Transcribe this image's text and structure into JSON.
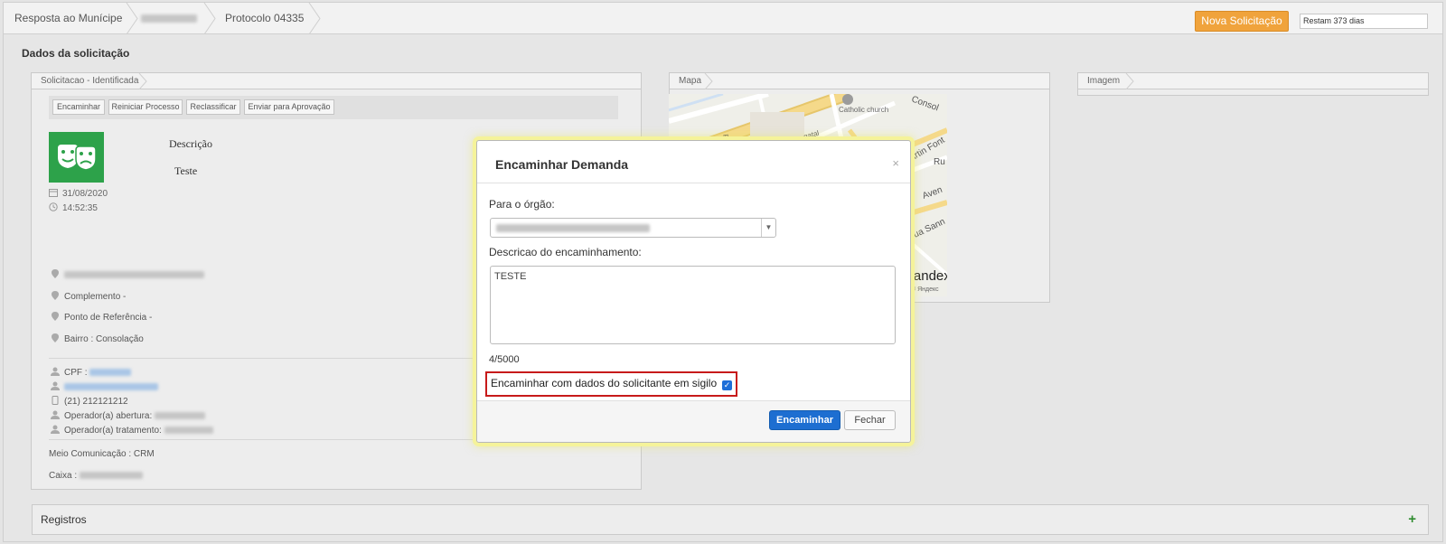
{
  "breadcrumb": {
    "item1": "Resposta ao Munícipe",
    "item3": "Protocolo 04335"
  },
  "header": {
    "new_request_label": "Nova Solicitação",
    "days_remaining": "Restam 373 dias"
  },
  "section_title": "Dados da solicitação",
  "request_panel": {
    "tab_label": "Solicitacao - Identificada",
    "actions": [
      "Encaminhar",
      "Reiniciar Processo",
      "Reclassificar",
      "Enviar para Aprovação"
    ],
    "description_title": "Descrição",
    "description_text": "Teste",
    "date": "31/08/2020",
    "time": "14:52:35",
    "complement": "Complemento -",
    "reference": "Ponto de Referência -",
    "district": "Bairro : Consolação",
    "cpf_label": "CPF :",
    "phone": "(21) 212121212",
    "operator_open_label": "Operador(a) abertura:",
    "operator_treat_label": "Operador(a) tratamento:",
    "channel": "Meio Comunicação : CRM",
    "box_label": "Caixa :"
  },
  "map_panel": {
    "tab_label": "Mapa",
    "labels": [
      "Catholic church",
      "Consol",
      "Martin Font",
      "Aven",
      "Rua Sann",
      "gatal",
      "Rua",
      "Ru",
      "Yandex",
      "© Яндекс"
    ]
  },
  "image_panel": {
    "tab_label": "Imagem"
  },
  "registros": {
    "label": "Registros",
    "add": "+"
  },
  "modal": {
    "title": "Encaminhar Demanda",
    "close": "×",
    "organ_label": "Para o órgão:",
    "description_label": "Descricao do encaminhamento:",
    "description_value": "TESTE",
    "char_count": "4/5000",
    "confidential_label": "Encaminhar com dados do solicitante em sigilo",
    "confidential_checked": true,
    "submit_label": "Encaminhar",
    "close_label": "Fechar"
  },
  "colors": {
    "accent_orange": "#f0a33c",
    "primary_blue": "#1d6ed1",
    "highlight_red": "#c71a1a",
    "avatar_green": "#2da24a"
  }
}
